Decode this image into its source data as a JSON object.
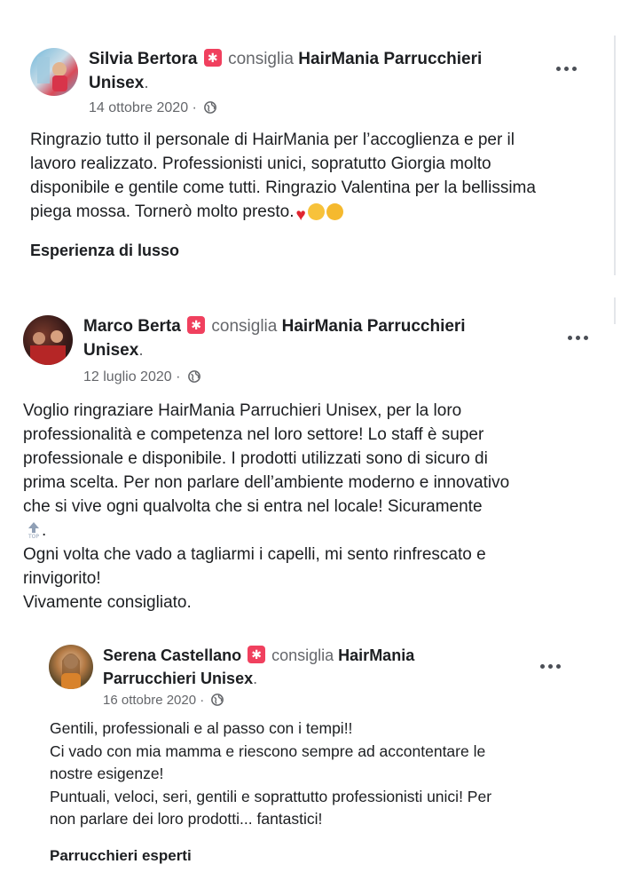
{
  "posts": [
    {
      "author": "Silvia Bertora",
      "recommends": "consiglia",
      "page_line1": "HairMania Parrucchieri",
      "page_line2": "Unisex",
      "date": "14 ottobre 2020",
      "text": "Ringrazio tutto il personale di HairMania per l’accoglienza e per il\nlavoro realizzato. Professionisti unici, sopratutto Giorgia molto\ndisponibile e gentile come tutti. Ringrazio Valentina per la bellissima\npiega mossa. Tornerò molto presto.",
      "tag": "Esperienza di lusso"
    },
    {
      "author": "Marco Berta",
      "recommends": "consiglia",
      "page_line1": "HairMania Parrucchieri",
      "page_line2": "Unisex",
      "date": "12 luglio 2020",
      "text": "Voglio ringraziare HairMania Parruchieri Unisex, per la loro\nprofessionalità e competenza nel loro settore! Lo staff è super\nprofessionale e disponibile. I prodotti utilizzati sono di sicuro di\nprima scelta. Per non parlare dell’ambiente moderno e innovativo\nche si vive ogni qualvolta che si entra nel locale! Sicuramente",
      "text_after_emoji": ".",
      "text2": "Ogni volta che vado a tagliarmi i capelli, mi sento rinfrescato e\nrinvigorito!\nVivamente consigliato."
    },
    {
      "author": "Serena Castellano",
      "recommends": "consiglia",
      "page_line1": "HairMania",
      "page_line2": "Parrucchieri Unisex",
      "date": "16 ottobre 2020",
      "text": "Gentili, professionali e al passo con i tempi!!\nCi vado con mia mamma e riescono sempre ad accontentare le\nnostre esigenze!\nPuntuali, veloci, seri, gentili e soprattutto professionisti unici! Per\nnon parlare dei loro prodotti... fantastici!",
      "tag": "Parrucchieri esperti"
    }
  ],
  "colors": {
    "badge": "#f0405e",
    "muted": "#65676b",
    "text": "#1c1e21"
  },
  "icons": {
    "badge": "recommend-badge-icon",
    "privacy": "globe-icon",
    "menu": "more-options-icon"
  }
}
